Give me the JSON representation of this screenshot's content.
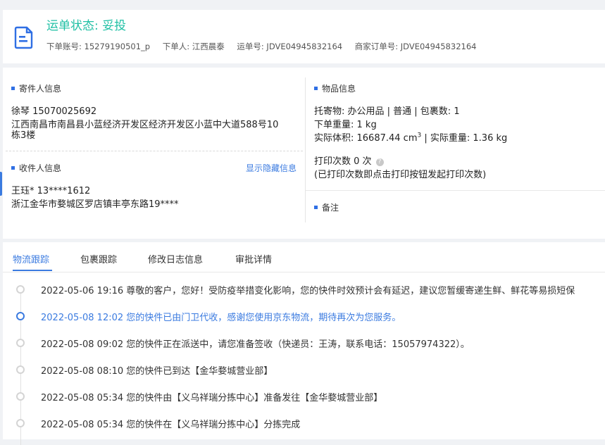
{
  "header": {
    "status": "运单状态: 妥投",
    "account": "下单账号: 15279190501_p",
    "orderer": "下单人: 江西晨泰",
    "waybill": "运单号: JDVE04945832164",
    "merchant_order": "商家订单号: JDVE04945832164"
  },
  "sender": {
    "title": "寄件人信息",
    "name_phone": "徐琴   15070025692",
    "address_line1": "江西南昌市南昌县小蓝经济开发区经济开发区小蓝中大道588号10",
    "address_line2": "栋3楼"
  },
  "receiver": {
    "title": "收件人信息",
    "show_hidden": "显示隐藏信息",
    "name_phone": "王珏*   13****1612",
    "address": "浙江金华市婺城区罗店镇丰亭东路19****"
  },
  "goods": {
    "title": "物品信息",
    "line1": "托寄物:  办公用品 | 普通  |  包裹数:  1",
    "line2": "下单重量:  1 kg",
    "volume_label": "实际体积:   16687.44 cm",
    "volume_sup": "3",
    "volume_rest": "  |  实际重量:   1.36 kg",
    "print_count": "打印次数   0 次",
    "print_hint": "(已打印次数即点击打印按钮发起打印次数)"
  },
  "remark": {
    "title": "备注"
  },
  "tabs": [
    "物流跟踪",
    "包裹跟踪",
    "修改日志信息",
    "审批详情"
  ],
  "tracking": [
    {
      "text": "2022-05-06 19:16 尊敬的客户，您好！受防疫举措变化影响，您的快件时效预计会有延迟，建议您暂缓寄递生鲜、鲜花等易损短保",
      "active": false
    },
    {
      "text": "2022-05-08 12:02 您的快件已由门卫代收，感谢您使用京东物流，期待再次为您服务。",
      "active": true
    },
    {
      "text": "2022-05-08 09:02 您的快件正在派送中，请您准备签收（快递员：王涛，联系电话：15057974322）。",
      "active": false
    },
    {
      "text": "2022-05-08 08:10 您的快件已到达【金华婺城营业部】",
      "active": false
    },
    {
      "text": "2022-05-08 05:34 您的快件由【义乌祥瑞分拣中心】准备发往【金华婺城营业部】",
      "active": false
    },
    {
      "text": "2022-05-08 05:34 您的快件在【义乌祥瑞分拣中心】分拣完成",
      "active": false
    }
  ],
  "colors": {
    "status": "#21c0a5",
    "accent": "#3b7be0",
    "section_marker": "#2f6fe4"
  },
  "icons": {
    "header": "document-icon",
    "help": "question-circle-icon"
  }
}
